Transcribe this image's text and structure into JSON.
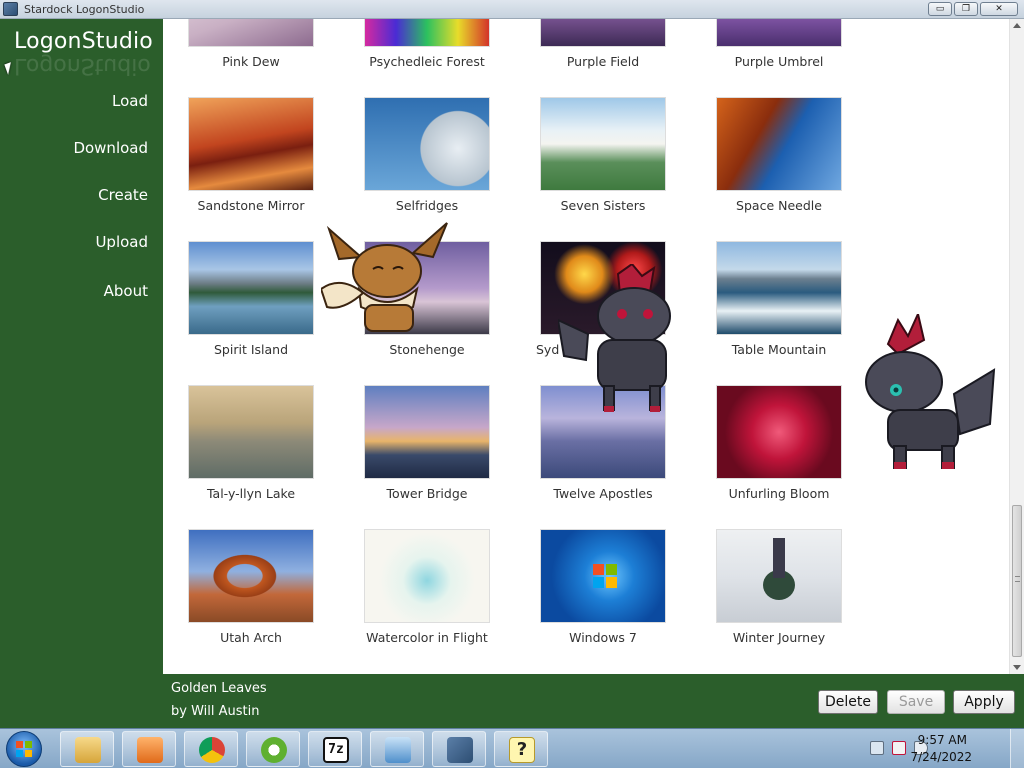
{
  "window": {
    "title": "Stardock LogonStudio",
    "controls": {
      "minimize": "▭",
      "maximize": "❐",
      "close": "✕"
    }
  },
  "sidebar": {
    "brand": "LogonStudio",
    "items": [
      {
        "label": "Load"
      },
      {
        "label": "Download"
      },
      {
        "label": "Create"
      },
      {
        "label": "Upload"
      },
      {
        "label": "About"
      }
    ]
  },
  "gallery": {
    "rows": [
      [
        "Pink Dew",
        "Psychedleic Forest",
        "Purple Field",
        "Purple Umbrel"
      ],
      [
        "Sandstone Mirror",
        "Selfridges",
        "Seven Sisters",
        "Space Needle"
      ],
      [
        "Spirit Island",
        "Stonehenge",
        "Syd",
        "Table Mountain"
      ],
      [
        "Tal-y-llyn Lake",
        "Tower Bridge",
        "Twelve Apostles",
        "Unfurling Bloom"
      ],
      [
        "Utah Arch",
        "Watercolor in Flight",
        "Windows 7",
        "Winter Journey"
      ]
    ]
  },
  "selection": {
    "name": "Golden Leaves",
    "author": "by Will Austin"
  },
  "actions": {
    "delete": "Delete",
    "save": "Save",
    "apply": "Apply"
  },
  "taskbar": {
    "items": [
      "explorer",
      "media-player",
      "chrome",
      "app-green",
      "7-zip",
      "control-panel",
      "logonstudio",
      "help"
    ],
    "time": "9:57 AM",
    "date": "7/24/2022"
  },
  "colors": {
    "panel_green": "#2b5e2b",
    "content_bg": "#ffffff"
  }
}
